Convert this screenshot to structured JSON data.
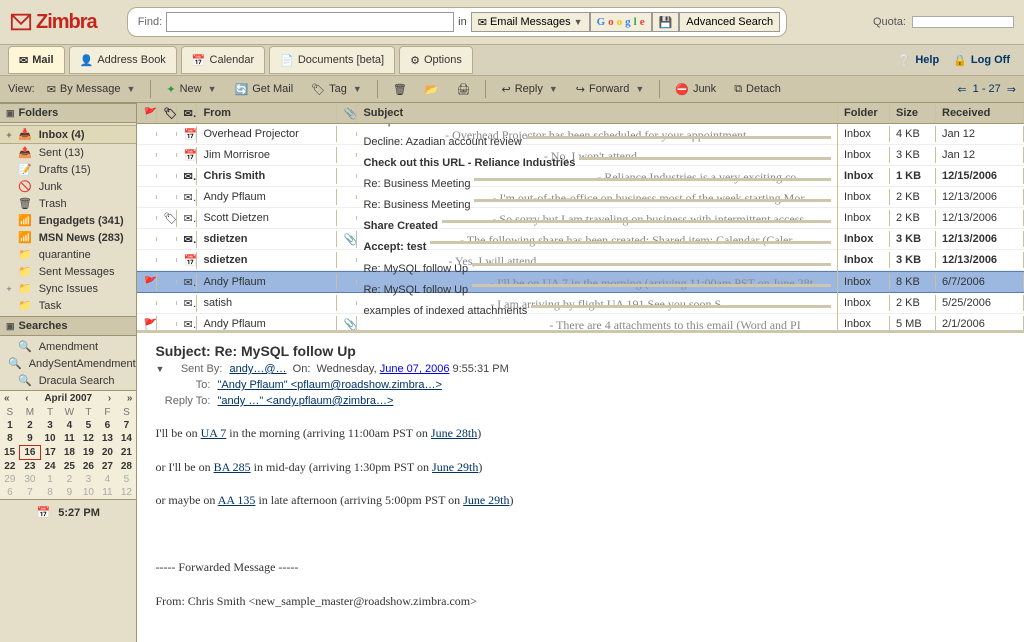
{
  "brand": "Zimbra",
  "search": {
    "find_label": "Find:",
    "value": "",
    "in_label": "in",
    "scope_label": "Email Messages",
    "google_label": "Google",
    "adv_label": "Advanced Search"
  },
  "quota": {
    "label": "Quota:"
  },
  "tabs": {
    "mail": "Mail",
    "address": "Address Book",
    "calendar": "Calendar",
    "docs": "Documents [beta]",
    "options": "Options"
  },
  "links": {
    "help": "Help",
    "logoff": "Log Off"
  },
  "view": {
    "label": "View:",
    "mode": "By Message"
  },
  "toolbar": {
    "new": "New",
    "getmail": "Get Mail",
    "tag": "Tag",
    "reply": "Reply",
    "forward": "Forward",
    "junk": "Junk",
    "detach": "Detach",
    "pager": "1 - 27"
  },
  "sidebar": {
    "folders_hdr": "Folders",
    "items": [
      {
        "label": "Inbox (4)",
        "sel": true,
        "tw": "+",
        "icon": "📥"
      },
      {
        "label": "Sent (13)",
        "tw": "",
        "icon": "📤"
      },
      {
        "label": "Drafts (15)",
        "tw": "",
        "icon": "📝"
      },
      {
        "label": "Junk",
        "tw": "",
        "icon": "🚫"
      },
      {
        "label": "Trash",
        "tw": "",
        "icon": "🗑"
      },
      {
        "label": "Engadgets (341)",
        "rss": true,
        "tw": "",
        "icon": "📶"
      },
      {
        "label": "MSN News (283)",
        "rss": true,
        "tw": "",
        "icon": "📶"
      },
      {
        "label": "quarantine",
        "tw": "",
        "icon": "📁"
      },
      {
        "label": "Sent Messages",
        "tw": "",
        "icon": "📁"
      },
      {
        "label": "Sync Issues",
        "tw": "+",
        "icon": "📁"
      },
      {
        "label": "Task",
        "tw": "",
        "icon": "📁"
      }
    ],
    "searches_hdr": "Searches",
    "searches": [
      {
        "label": "Amendment"
      },
      {
        "label": "AndySentAmendments"
      },
      {
        "label": "Dracula Search"
      }
    ]
  },
  "calendar": {
    "title": "April 2007",
    "days": [
      "S",
      "M",
      "T",
      "W",
      "T",
      "F",
      "S"
    ],
    "rows": [
      [
        "1",
        "2",
        "3",
        "4",
        "5",
        "6",
        "7"
      ],
      [
        "8",
        "9",
        "10",
        "11",
        "12",
        "13",
        "14"
      ],
      [
        "15",
        "16",
        "17",
        "18",
        "19",
        "20",
        "21"
      ],
      [
        "22",
        "23",
        "24",
        "25",
        "26",
        "27",
        "28"
      ],
      [
        "29",
        "30",
        "1",
        "2",
        "3",
        "4",
        "5"
      ],
      [
        "6",
        "7",
        "8",
        "9",
        "10",
        "11",
        "12"
      ]
    ],
    "today": "16"
  },
  "clock": "5:27 PM",
  "columns": {
    "from": "From",
    "subject": "Subject",
    "folder": "Folder",
    "size": "Size",
    "received": "Received"
  },
  "messages": [
    {
      "from": "Overhead Projector",
      "subj": "Accept: Test",
      "prev": " - Overhead Projector has been scheduled for your appointment.",
      "folder": "Inbox",
      "size": "4 KB",
      "rcvd": "Jan 12",
      "cal": true
    },
    {
      "from": "Jim Morrisroe",
      "subj": "Decline: Azadian account review",
      "prev": " - No, I won't attend.",
      "folder": "Inbox",
      "size": "3 KB",
      "rcvd": "Jan 12",
      "cal": true
    },
    {
      "from": "Chris Smith",
      "subj": "Check out this URL - Reliance Industries",
      "prev": " - Reliance Industries is a very exciting co",
      "folder": "Inbox",
      "size": "1 KB",
      "rcvd": "12/15/2006",
      "unread": true
    },
    {
      "from": "Andy Pflaum",
      "subj": "Re: Business Meeting",
      "prev": " - I'm out-of-the-office on business most of the week starting Mor",
      "folder": "Inbox",
      "size": "2 KB",
      "rcvd": "12/13/2006"
    },
    {
      "from": "Scott Dietzen",
      "subj": "Re: Business Meeting",
      "prev": " - So sorry but I am traveling on business with intermittent access",
      "folder": "Inbox",
      "size": "2 KB",
      "rcvd": "12/13/2006",
      "tag": true
    },
    {
      "from": "sdietzen",
      "subj": "Share Created",
      "prev": " - The following share has been created: Shared item: Calendar (Caler",
      "folder": "Inbox",
      "size": "3 KB",
      "rcvd": "12/13/2006",
      "unread": true,
      "att": true
    },
    {
      "from": "sdietzen",
      "subj": "Accept: test",
      "prev": " - Yes, I will attend.",
      "folder": "Inbox",
      "size": "3 KB",
      "rcvd": "12/13/2006",
      "unread": true,
      "cal": true
    },
    {
      "from": "Andy Pflaum",
      "subj": "Re: MySQL follow Up",
      "prev": " - I'll be on UA 7 in the morning (arriving 11:00am PST on June 28t",
      "folder": "Inbox",
      "size": "8 KB",
      "rcvd": "6/7/2006",
      "flag": true,
      "sel": true
    },
    {
      "from": "satish",
      "subj": "Re: MySQL follow Up",
      "prev": " - I am arriving by flight UA 191 See you soon S",
      "folder": "Inbox",
      "size": "2 KB",
      "rcvd": "5/25/2006"
    },
    {
      "from": "Andy Pflaum",
      "subj": "examples of indexed attachments",
      "prev": " - There are 4 attachments to this email (Word and PI",
      "folder": "Inbox",
      "size": "5 MB",
      "rcvd": "2/1/2006",
      "flag": true,
      "att": true
    }
  ],
  "preview": {
    "subject_label": "Subject: ",
    "subject": "Re: MySQL follow Up",
    "sentby_label": "Sent By:",
    "on_label": "On:",
    "on_day": "Wednesday,",
    "on_date": "June 07, 2006",
    "on_time": "9:55:31 PM",
    "to_label": "To:",
    "to_value": "\"Andy Pflaum\" <pflaum@roadshow.zimbra…>",
    "reply_label": "Reply To:",
    "reply_value": "\"andy …\" <andy.pflaum@zimbra…>",
    "body_l1a": "I'll be on ",
    "body_l1b": "UA 7",
    "body_l1c": " in the morning (arriving 11:00am PST on ",
    "body_l1d": "June 28th",
    "body_l1e": ")",
    "body_l2a": "or I'll be on ",
    "body_l2b": "BA 285",
    "body_l2c": " in mid-day (arriving 1:30pm PST on ",
    "body_l2d": "June 29th",
    "body_l2e": ")",
    "body_l3a": "or maybe on ",
    "body_l3b": "AA 135",
    "body_l3c": " in late afternoon (arriving 5:00pm PST on ",
    "body_l3d": "June 29th",
    "body_l3e": ")",
    "fwd_hdr": "----- Forwarded Message -----",
    "fwd_from": "From: Chris Smith <new_sample_master@roadshow.zimbra.com>"
  }
}
